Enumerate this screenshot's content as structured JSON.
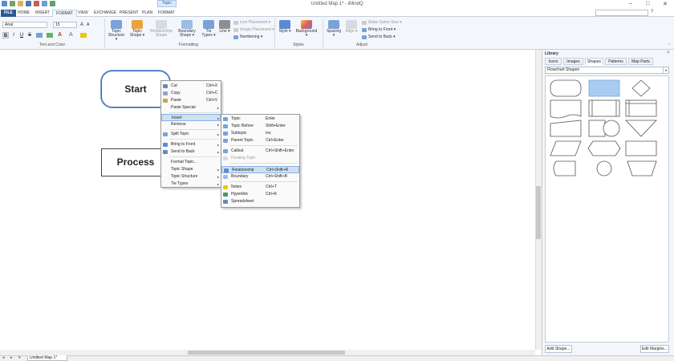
{
  "window": {
    "context_tab": "Topic",
    "title": "Untitled Map 1* - iMindQ",
    "minimize": "–",
    "maximize": "□",
    "close": "✕"
  },
  "tabs": [
    "FILE",
    "HOME",
    "INSERT",
    "FORMAT",
    "VIEW",
    "EXCHANGE",
    "PRESENT",
    "PLAN",
    "FORMAT"
  ],
  "ribbon": {
    "font_name": "Arial",
    "font_size": "15",
    "bold": "B",
    "italic": "I",
    "underline": "U",
    "strike": "S",
    "groups": {
      "text_color": "Text and Color",
      "formatting": "Formatting",
      "styles": "Styles",
      "adjust": "Adjust"
    },
    "buttons": {
      "topic_structure": "Topic Structure ▾",
      "topic_shape": "Topic Shape ▾",
      "relationship_shape": "Relationship Shape",
      "boundary_shape": "Boundary Shape ▾",
      "tie_types": "Tie Types ▾",
      "line": "Line ▾",
      "icon_placement": "Icon Placement ▾",
      "image_placement": "Image Placement ▾",
      "numbering": "Numbering ▾",
      "style": "Style ▾",
      "background": "Background ▾",
      "spacing": "Spacing ▾",
      "align": "Align ▾",
      "make_same_size": "Make Same Size ▾",
      "bring_to_front": "Bring to Front ▾",
      "send_to_back": "Send to Back ▾"
    }
  },
  "canvas": {
    "nodes": {
      "start": "Start",
      "process": "Process"
    }
  },
  "context_menu": [
    {
      "label": "Cut",
      "shortcut": "Ctrl+X",
      "icon": "scissors-icon"
    },
    {
      "label": "Copy",
      "shortcut": "Ctrl+C",
      "icon": "copy-icon"
    },
    {
      "label": "Paste",
      "shortcut": "Ctrl+V",
      "icon": "paste-icon"
    },
    {
      "label": "Paste Special",
      "shortcut": "",
      "icon": ""
    },
    {
      "label": "Insert",
      "shortcut": "",
      "icon": ""
    },
    {
      "label": "Remove",
      "shortcut": "",
      "icon": ""
    },
    {
      "label": "Split Topic",
      "shortcut": "",
      "icon": "split-icon"
    },
    {
      "label": "Bring to Front",
      "shortcut": "",
      "icon": "bring-front-icon"
    },
    {
      "label": "Send to Back",
      "shortcut": "",
      "icon": "send-back-icon"
    },
    {
      "label": "Format Topic...",
      "shortcut": "",
      "icon": ""
    },
    {
      "label": "Topic Shape",
      "shortcut": "",
      "icon": ""
    },
    {
      "label": "Topic Structure",
      "shortcut": "",
      "icon": ""
    },
    {
      "label": "Tie Types",
      "shortcut": "",
      "icon": ""
    }
  ],
  "insert_submenu": [
    {
      "label": "Topic",
      "shortcut": "Enter"
    },
    {
      "label": "Topic Before",
      "shortcut": "Shift+Enter"
    },
    {
      "label": "Subtopic",
      "shortcut": "Ins"
    },
    {
      "label": "Parent Topic",
      "shortcut": "Ctrl+Enter"
    },
    {
      "label": "Callout",
      "shortcut": "Ctrl+Shift+Enter"
    },
    {
      "label": "Floating Topic",
      "shortcut": ""
    },
    {
      "label": "Relationship",
      "shortcut": "Ctrl+Shift+R"
    },
    {
      "label": "Boundary",
      "shortcut": "Ctrl+Shift+B"
    },
    {
      "label": "Notes",
      "shortcut": "Ctrl+T"
    },
    {
      "label": "Hyperlink",
      "shortcut": "Ctrl+K"
    },
    {
      "label": "Spreadsheet",
      "shortcut": ""
    }
  ],
  "library": {
    "title": "Library",
    "close": "×",
    "tabs": [
      "Icons",
      "Images",
      "Shapes",
      "Patterns",
      "Map Parts"
    ],
    "selected_set": "Flowchart Shapes",
    "add_shape": "Add Shape...",
    "edit_margins": "Edit Margins..."
  },
  "document_tab": "Untitled Map 1*",
  "colors": {
    "file_tab": "#2b5797",
    "highlight": "#cfe0f5",
    "selected_shape": "#a9cdf2",
    "accent": "#3a64a8"
  }
}
